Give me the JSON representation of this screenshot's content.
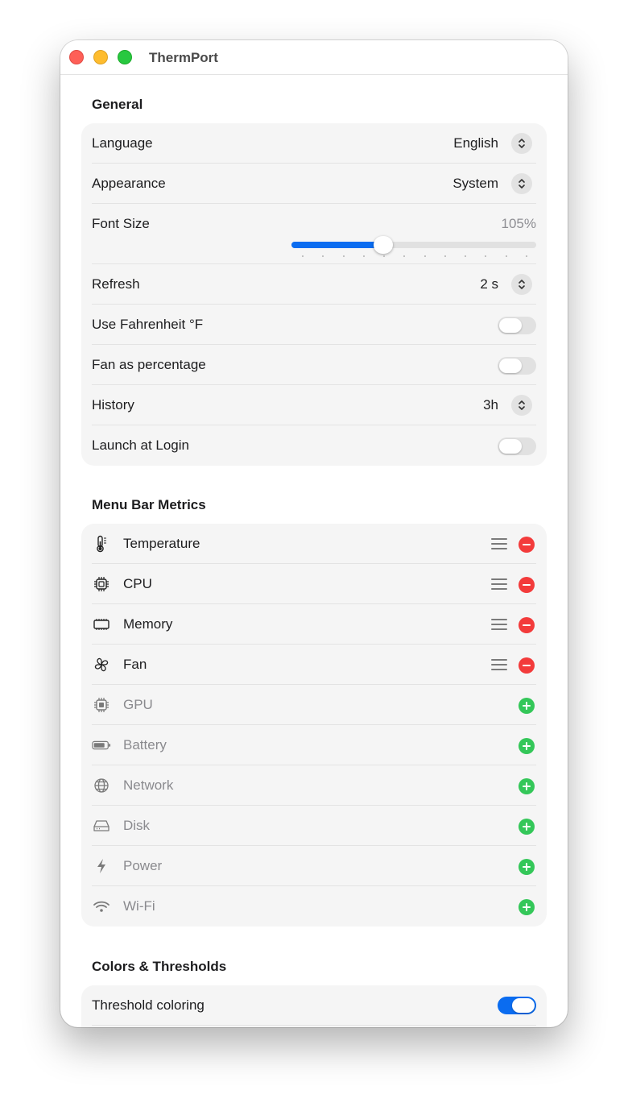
{
  "window": {
    "title": "ThermPort"
  },
  "general": {
    "title": "General",
    "language": {
      "label": "Language",
      "value": "English"
    },
    "appearance": {
      "label": "Appearance",
      "value": "System"
    },
    "font_size": {
      "label": "Font Size",
      "value": "105%",
      "slider_fraction": 0.375
    },
    "refresh": {
      "label": "Refresh",
      "value": "2 s"
    },
    "fahrenheit": {
      "label": "Use Fahrenheit °F",
      "on": false
    },
    "fan_percentage": {
      "label": "Fan as percentage",
      "on": false
    },
    "history": {
      "label": "History",
      "value": "3h"
    },
    "launch_login": {
      "label": "Launch at Login",
      "on": false
    }
  },
  "menu_bar": {
    "title": "Menu Bar Metrics",
    "active": [
      {
        "label": "Temperature",
        "icon": "thermometer-icon"
      },
      {
        "label": "CPU",
        "icon": "cpu-icon"
      },
      {
        "label": "Memory",
        "icon": "memory-icon"
      },
      {
        "label": "Fan",
        "icon": "fan-icon"
      }
    ],
    "inactive": [
      {
        "label": "GPU",
        "icon": "gpu-icon"
      },
      {
        "label": "Battery",
        "icon": "battery-icon"
      },
      {
        "label": "Network",
        "icon": "globe-icon"
      },
      {
        "label": "Disk",
        "icon": "disk-icon"
      },
      {
        "label": "Power",
        "icon": "bolt-icon"
      },
      {
        "label": "Wi-Fi",
        "icon": "wifi-icon"
      }
    ]
  },
  "colors": {
    "title": "Colors & Thresholds",
    "threshold_coloring": {
      "label": "Threshold coloring",
      "on": true
    }
  },
  "palette": {
    "accent": "#0a6cf0",
    "remove": "#f33b3b",
    "add": "#34c759"
  }
}
